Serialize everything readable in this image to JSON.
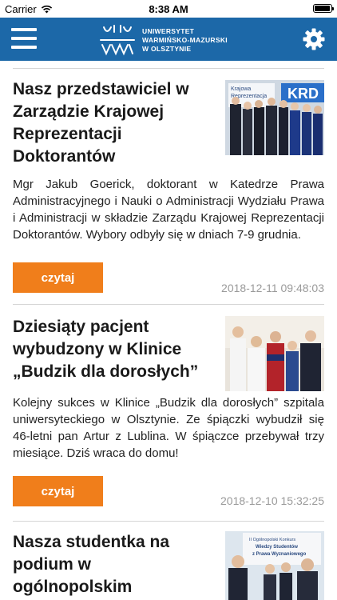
{
  "status_bar": {
    "carrier": "Carrier",
    "time": "8:38 AM"
  },
  "header": {
    "logo_line1": "UNIWERSYTET",
    "logo_line2": "WARMIŃSKO-MAZURSKI",
    "logo_line3": "W OLSZTYNIE",
    "brand_color": "#1c68a8"
  },
  "articles": [
    {
      "title": "Nasz przedstawiciel w Zarządzie Krajowej Reprezentacji Doktorantów",
      "body": "Mgr Jakub Goerick, doktorant w Katedrze Prawa Administracyjnego i Nauki o Administracji Wydziału Prawa i Administracji w składzie Zarządu Krajowej Reprezentacji Doktorantów. Wybory odbyły się w dniach 7-9 grudnia.",
      "button": "czytaj",
      "date": "2018-12-11 09:48:03",
      "thumb_sign1": "Krajowa",
      "thumb_sign2": "Reprezentacja",
      "thumb_sign3": "KRD"
    },
    {
      "title": "Dziesiąty pacjent wybudzony w Klinice „Budzik dla dorosłych”",
      "body": "Kolejny sukces w Klinice „Budzik dla dorosłych” szpitala uniwersyteckiego w Olsztynie. Ze śpiączki wybudził się 46-letni pan Artur z Lublina. W śpiączce przebywał trzy miesiące. Dziś wraca do domu!",
      "button": "czytaj",
      "date": "2018-12-10 15:32:25"
    },
    {
      "title": "Nasza studentka na podium w ogólnopolskim",
      "thumb_sign1": "II Ogólnopolski Konkurs",
      "thumb_sign2": "Wiedzy Studentów",
      "thumb_sign3": "z Prawa Wyznaniowego"
    }
  ],
  "accent_color": "#f07e1b"
}
